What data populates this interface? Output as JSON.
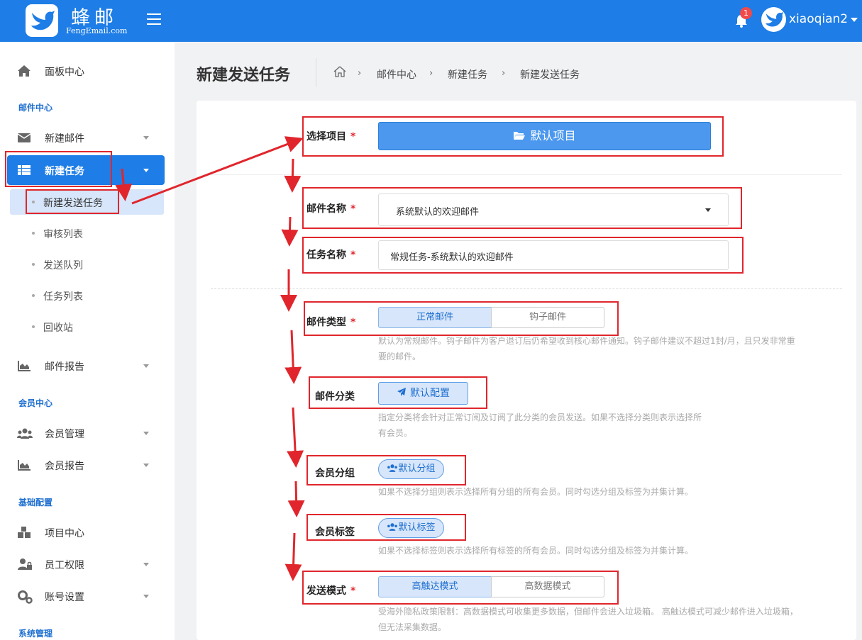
{
  "header": {
    "logo_text": "蜂邮",
    "logo_sub": "FengEmail.com",
    "notification_count": "1",
    "username": "xiaoqian2"
  },
  "sidebar": {
    "dashboard": "面板中心",
    "section_mail": "邮件中心",
    "new_mail": "新建邮件",
    "new_task": "新建任务",
    "sub_items": [
      "新建发送任务",
      "审核列表",
      "发送队列",
      "任务列表",
      "回收站"
    ],
    "mail_report": "邮件报告",
    "section_member": "会员中心",
    "member_mgmt": "会员管理",
    "member_report": "会员报告",
    "section_basic": "基础配置",
    "project_center": "项目中心",
    "staff_perm": "员工权限",
    "account_settings": "账号设置",
    "section_system": "系统管理"
  },
  "page": {
    "title": "新建发送任务",
    "breadcrumb": [
      "邮件中心",
      "新建任务",
      "新建发送任务"
    ]
  },
  "form": {
    "project_label": "选择项目",
    "project_button": "默认项目",
    "mail_name_label": "邮件名称",
    "mail_name_value": "系统默认的欢迎邮件",
    "task_name_label": "任务名称",
    "task_name_value": "常规任务-系统默认的欢迎邮件",
    "mail_type_label": "邮件类型",
    "mail_type_options": [
      "正常邮件",
      "钩子邮件"
    ],
    "mail_type_help_1": "默认为常规邮件。钩子邮件为客户退订后仍希望收到核心邮件通知。钩子邮件建议不超过1封/月，且只发非常重",
    "mail_type_help_2": "要的邮件。",
    "category_label": "邮件分类",
    "category_button": "默认配置",
    "category_help_1": "指定分类将会针对正常订阅及订阅了此分类的会员发送。如果不选择分类则表示选择所",
    "category_help_2": "有会员。",
    "group_label": "会员分组",
    "group_button": "默认分组",
    "group_help": "如果不选择分组则表示选择所有分组的所有会员。同时勾选分组及标签为并集计算。",
    "tag_label": "会员标签",
    "tag_button": "默认标签",
    "tag_help": "如果不选择标签则表示选择所有标签的所有会员。同时勾选分组及标签为并集计算。",
    "mode_label": "发送模式",
    "mode_options": [
      "高触达模式",
      "高数据模式"
    ],
    "mode_help_1": "受海外隐私政策限制：高数据模式可收集更多数据，但邮件会进入垃圾箱。 高触达模式可减少邮件进入垃圾箱，",
    "mode_help_2": "但无法采集数据。",
    "required_mark": "*"
  },
  "colors": {
    "primary": "#1e7de6",
    "annotation_red": "#e0262c",
    "active_bg": "#d7e6fa"
  }
}
